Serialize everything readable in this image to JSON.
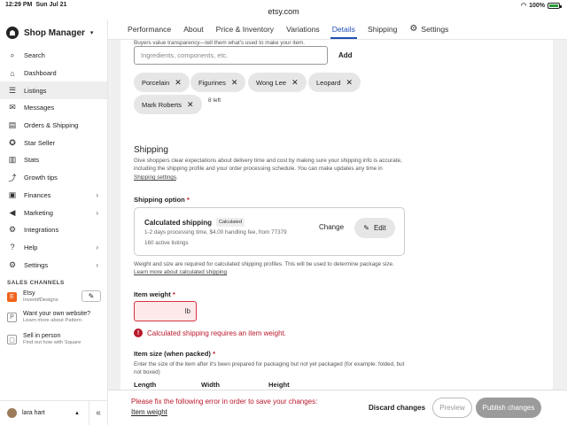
{
  "status_bar": {
    "time": "12:29 PM",
    "date": "Sun Jul 21",
    "url": "etsy.com",
    "battery": "100%",
    "battery_level": 1.0
  },
  "sidebar": {
    "title": "Shop Manager",
    "items": [
      {
        "label": "Search",
        "icon": "search-icon",
        "glyph": "⌕"
      },
      {
        "label": "Dashboard",
        "icon": "dashboard-icon",
        "glyph": "⌂"
      },
      {
        "label": "Listings",
        "icon": "listings-icon",
        "glyph": "☰",
        "active": true
      },
      {
        "label": "Messages",
        "icon": "messages-icon",
        "glyph": "✉"
      },
      {
        "label": "Orders & Shipping",
        "icon": "orders-icon",
        "glyph": "▤"
      },
      {
        "label": "Star Seller",
        "icon": "star-seller-icon",
        "glyph": "✪"
      },
      {
        "label": "Stats",
        "icon": "stats-icon",
        "glyph": "▥"
      },
      {
        "label": "Growth tips",
        "icon": "growth-icon",
        "glyph": "⤴"
      },
      {
        "label": "Finances",
        "icon": "finances-icon",
        "glyph": "▣",
        "chevron": "›"
      },
      {
        "label": "Marketing",
        "icon": "marketing-icon",
        "glyph": "◀",
        "chevron": "›"
      },
      {
        "label": "Integrations",
        "icon": "integrations-icon",
        "glyph": "⚙"
      },
      {
        "label": "Help",
        "icon": "help-icon",
        "glyph": "?",
        "chevron": "›"
      },
      {
        "label": "Settings",
        "icon": "settings-icon",
        "glyph": "⚙",
        "chevron": "›"
      }
    ],
    "sales_channels_heading": "SALES CHANNELS",
    "channels": [
      {
        "title": "Etsy",
        "sub": "InventifDesigns",
        "icon_text": "E"
      },
      {
        "title": "Want your own website?",
        "sub": "Learn more about Pattern",
        "icon_text": "P"
      },
      {
        "title": "Sell in person",
        "sub": "Find out how with Square",
        "icon_text": "▢"
      }
    ],
    "user": "lara hart"
  },
  "tabs": [
    {
      "label": "Performance"
    },
    {
      "label": "About"
    },
    {
      "label": "Price & Inventory"
    },
    {
      "label": "Variations"
    },
    {
      "label": "Details",
      "active": true
    },
    {
      "label": "Shipping"
    },
    {
      "label": "Settings",
      "icon": "gear-icon"
    }
  ],
  "materials": {
    "hint": "Buyers value transparency—tell them what's used to make your item.",
    "placeholder": "Ingredients, components, etc.",
    "add_label": "Add",
    "chips": [
      "Porcelain",
      "Figurines",
      "Wong Lee",
      "Leopard",
      "Mark Roberts"
    ],
    "remaining": "8 left"
  },
  "shipping": {
    "heading": "Shipping",
    "description": "Give shoppers clear expectations about delivery time and cost by making sure your shipping info is accurate, including the shipping profile and your order processing schedule. You can make updates any time in ",
    "settings_link": "Shipping settings",
    "option_label": "Shipping option",
    "option": {
      "title": "Calculated shipping",
      "badge": "Calculated",
      "detail": "1-2 days processing time, $4.00 handling fee, from 77379",
      "listings": "160 active listings",
      "change_label": "Change",
      "edit_label": "Edit"
    },
    "note": "Weight and size are required for calculated shipping profiles. This will be used to determine package size. ",
    "note_link": "Learn more about calculated shipping",
    "weight_label": "Item weight",
    "weight_unit": "lb",
    "weight_value": "",
    "weight_error": "Calculated shipping requires an item weight.",
    "size_label": "Item size (when packed)",
    "size_desc": "Enter the size of the item after it's been prepared for packaging but not yet packaged (for example: folded, but not boxed)",
    "dims": [
      "Length",
      "Width",
      "Height"
    ]
  },
  "footer": {
    "error": "Please fix the following error in order to save your changes:",
    "error_link": "Item weight",
    "discard_label": "Discard changes",
    "preview_label": "Preview",
    "publish_label": "Publish changes"
  },
  "colors": {
    "accent": "#1f4fb5",
    "error": "#b9182a",
    "etsy_orange": "#f1641e"
  }
}
